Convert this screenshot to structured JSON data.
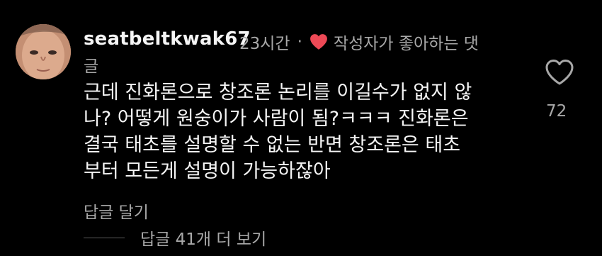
{
  "comment": {
    "username": "seatbeltkwak67",
    "timestamp": "23시간",
    "separator": "·",
    "liked_by_author_label_part1": "작성자가 좋아하는 댓",
    "liked_by_author_label_part2": "글",
    "text_lines": [
      "근데 진화론으로 창조론 논리를 이길수가 없지 않",
      "나? 어떻게 원숭이가 사람이 됨?ㅋㅋㅋ 진화론은",
      "결국 태초를 설명할 수 없는 반면 창조론은 태초",
      "부터 모든게 설명이 가능하잖아"
    ],
    "like_count": "72",
    "reply_label": "답글 달기",
    "view_replies_label": "답글 41개 더 보기"
  },
  "colors": {
    "background": "#000000",
    "primary_text": "#f5f5f5",
    "secondary_text": "#a8a8a8",
    "heart_red": "#ed4956"
  },
  "icons": {
    "avatar": "profile-photo",
    "liked_heart": "heart-filled-icon",
    "like_button": "heart-outline-icon"
  }
}
